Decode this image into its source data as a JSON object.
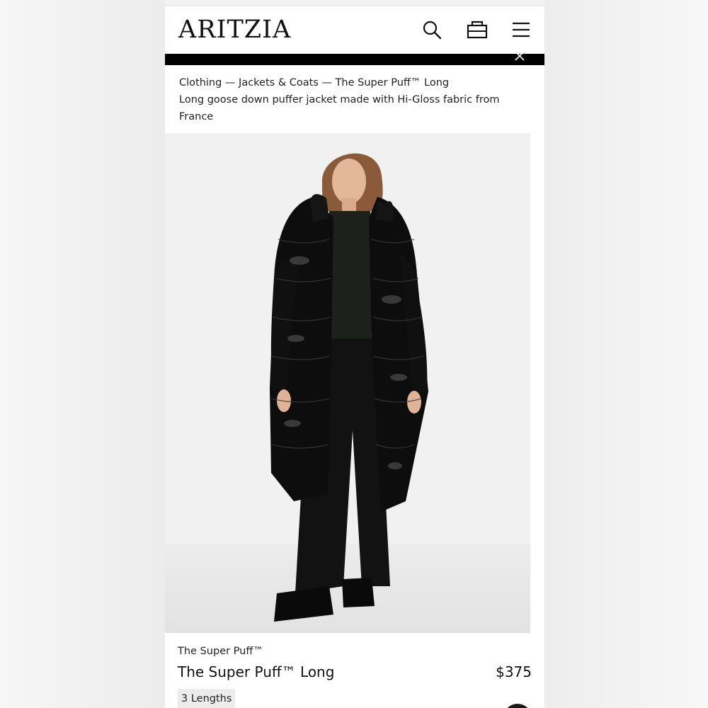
{
  "header": {
    "logo": "ARITZIA",
    "icons": [
      "search-icon",
      "shopping-bag-icon",
      "menu-icon"
    ]
  },
  "banner": {
    "text": "",
    "link": ""
  },
  "breadcrumb": {
    "path": "Clothing — Jackets & Coats — The Super Puff™ Long",
    "description": "Long goose down puffer jacket made with Hi-Gloss fabric from France"
  },
  "product": {
    "brand": "The Super Puff™",
    "name": "The Super Puff™ Long",
    "price": "$375",
    "variant": "3 Lengths"
  },
  "colors": {
    "background": "#f5f5f5",
    "page": "#ffffff",
    "text": "#111111",
    "banner": "#000000",
    "jacket": "#0d0d0d",
    "chip": "#ececec"
  }
}
